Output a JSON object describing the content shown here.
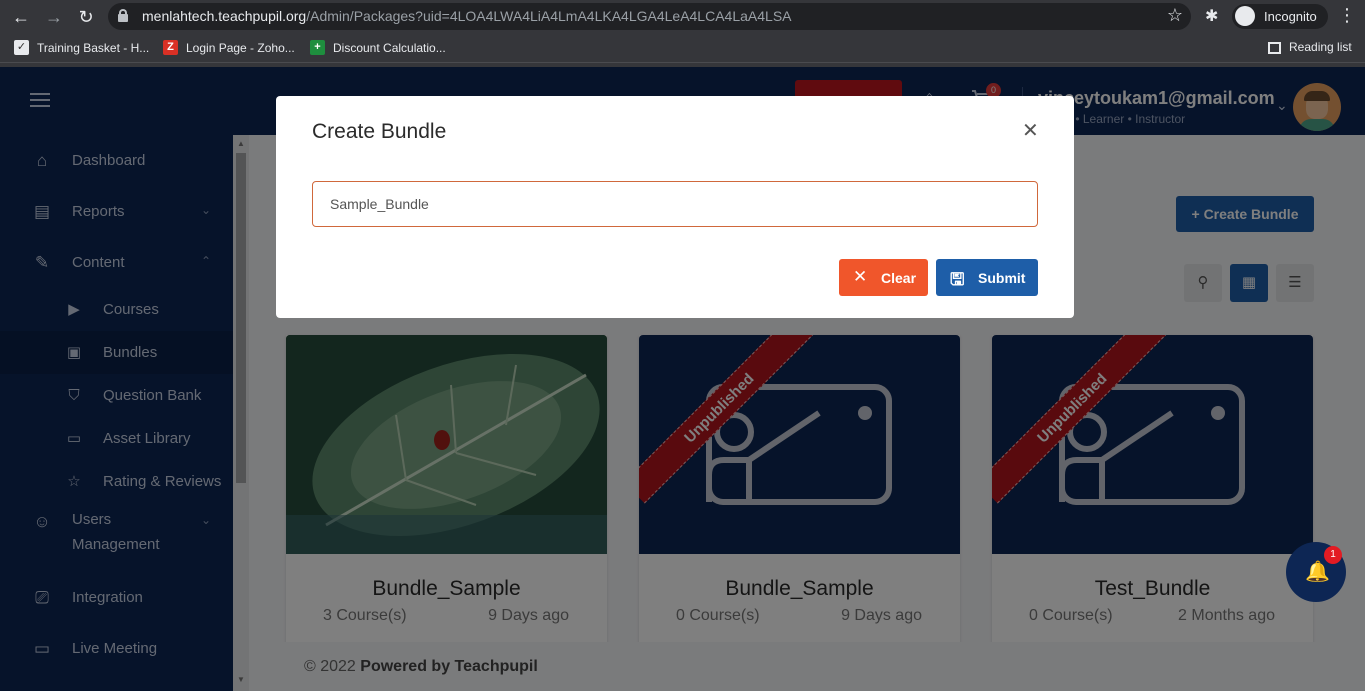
{
  "browser": {
    "url_host": "menlahtech.teachpupil.org",
    "url_path": "/Admin/Packages?uid=4LOA4LWA4LiA4LmA4LKA4LGA4LeA4LCA4LaA4LSA",
    "profile_label": "Incognito",
    "bookmarks": [
      {
        "label": "Training Basket - H..."
      },
      {
        "label": "Login Page - Zoho..."
      },
      {
        "label": "Discount Calculatio..."
      }
    ],
    "reading_list_label": "Reading list"
  },
  "header": {
    "cart_count": "0",
    "user_email": "vinceytoukam1@gmail.com",
    "user_roles": "Admin • Learner • Instructor"
  },
  "sidebar": {
    "items": [
      {
        "label": "Dashboard",
        "icon": "home-icon"
      },
      {
        "label": "Reports",
        "icon": "report-icon"
      },
      {
        "label": "Content",
        "icon": "content-icon"
      },
      {
        "label": "Courses",
        "icon": "play-icon"
      },
      {
        "label": "Bundles",
        "icon": "bundle-icon"
      },
      {
        "label": "Question Bank",
        "icon": "shield-question-icon"
      },
      {
        "label": "Asset Library",
        "icon": "archive-icon"
      },
      {
        "label": "Rating & Reviews",
        "icon": "star-icon"
      },
      {
        "label": "Users\nManagement",
        "icon": "users-icon"
      },
      {
        "label": "Integration",
        "icon": "cast-icon"
      },
      {
        "label": "Live Meeting",
        "icon": "presentation-icon"
      }
    ]
  },
  "main": {
    "create_button_label": "+ Create Bundle",
    "cards": [
      {
        "name": "Bundle_Sample",
        "count": "3 Course(s)",
        "ago": "9 Days ago",
        "ribbon": ""
      },
      {
        "name": "Bundle_Sample",
        "count": "0 Course(s)",
        "ago": "9 Days ago",
        "ribbon": "Unpublished"
      },
      {
        "name": "Test_Bundle",
        "count": "0 Course(s)",
        "ago": "2 Months ago",
        "ribbon": "Unpublished"
      }
    ]
  },
  "footer": {
    "copyright": "© 2022 ",
    "powered": "Powered by Teachpupil"
  },
  "modal": {
    "title": "Create Bundle",
    "input_value": "Sample_Bundle",
    "clear_label": "Clear",
    "submit_label": "Submit"
  },
  "notifications": {
    "count": "1"
  },
  "colors": {
    "navy": "#0d2654",
    "primary": "#1e5ea8",
    "danger": "#f0562b",
    "ribbon": "#b3141c"
  }
}
